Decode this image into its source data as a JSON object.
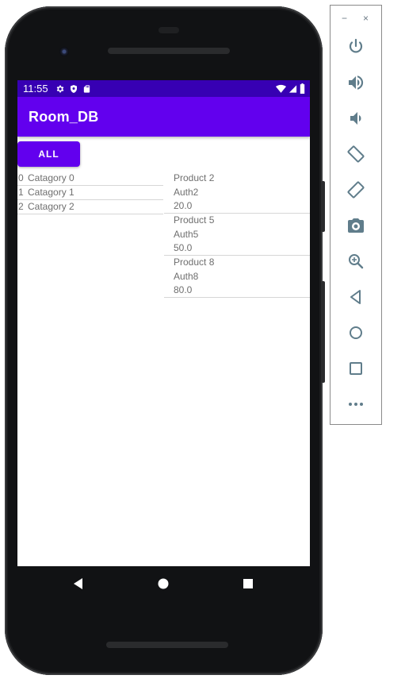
{
  "status_bar": {
    "time": "11:55"
  },
  "app_bar": {
    "title": "Room_DB"
  },
  "all_button": {
    "label": "ALL"
  },
  "categories": [
    {
      "id": "0",
      "name": "Catagory 0"
    },
    {
      "id": "1",
      "name": "Catagory 1"
    },
    {
      "id": "2",
      "name": "Catagory 2"
    }
  ],
  "products": [
    {
      "name": "Product 2",
      "author": "Auth2",
      "price": "20.0"
    },
    {
      "name": "Product 5",
      "author": "Auth5",
      "price": "50.0"
    },
    {
      "name": "Product 8",
      "author": "Auth8",
      "price": "80.0"
    }
  ],
  "emulator_toolbar": {
    "minimize": "−",
    "close": "×",
    "buttons": [
      "power-icon",
      "volume-up-icon",
      "volume-down-icon",
      "rotate-left-icon",
      "rotate-right-icon",
      "camera-icon",
      "zoom-icon",
      "back-icon",
      "home-icon",
      "overview-icon",
      "more-icon"
    ]
  },
  "colors": {
    "primary": "#6200ee",
    "primary_dark": "#3700b3",
    "toolbar_icon": "#607d8b"
  }
}
